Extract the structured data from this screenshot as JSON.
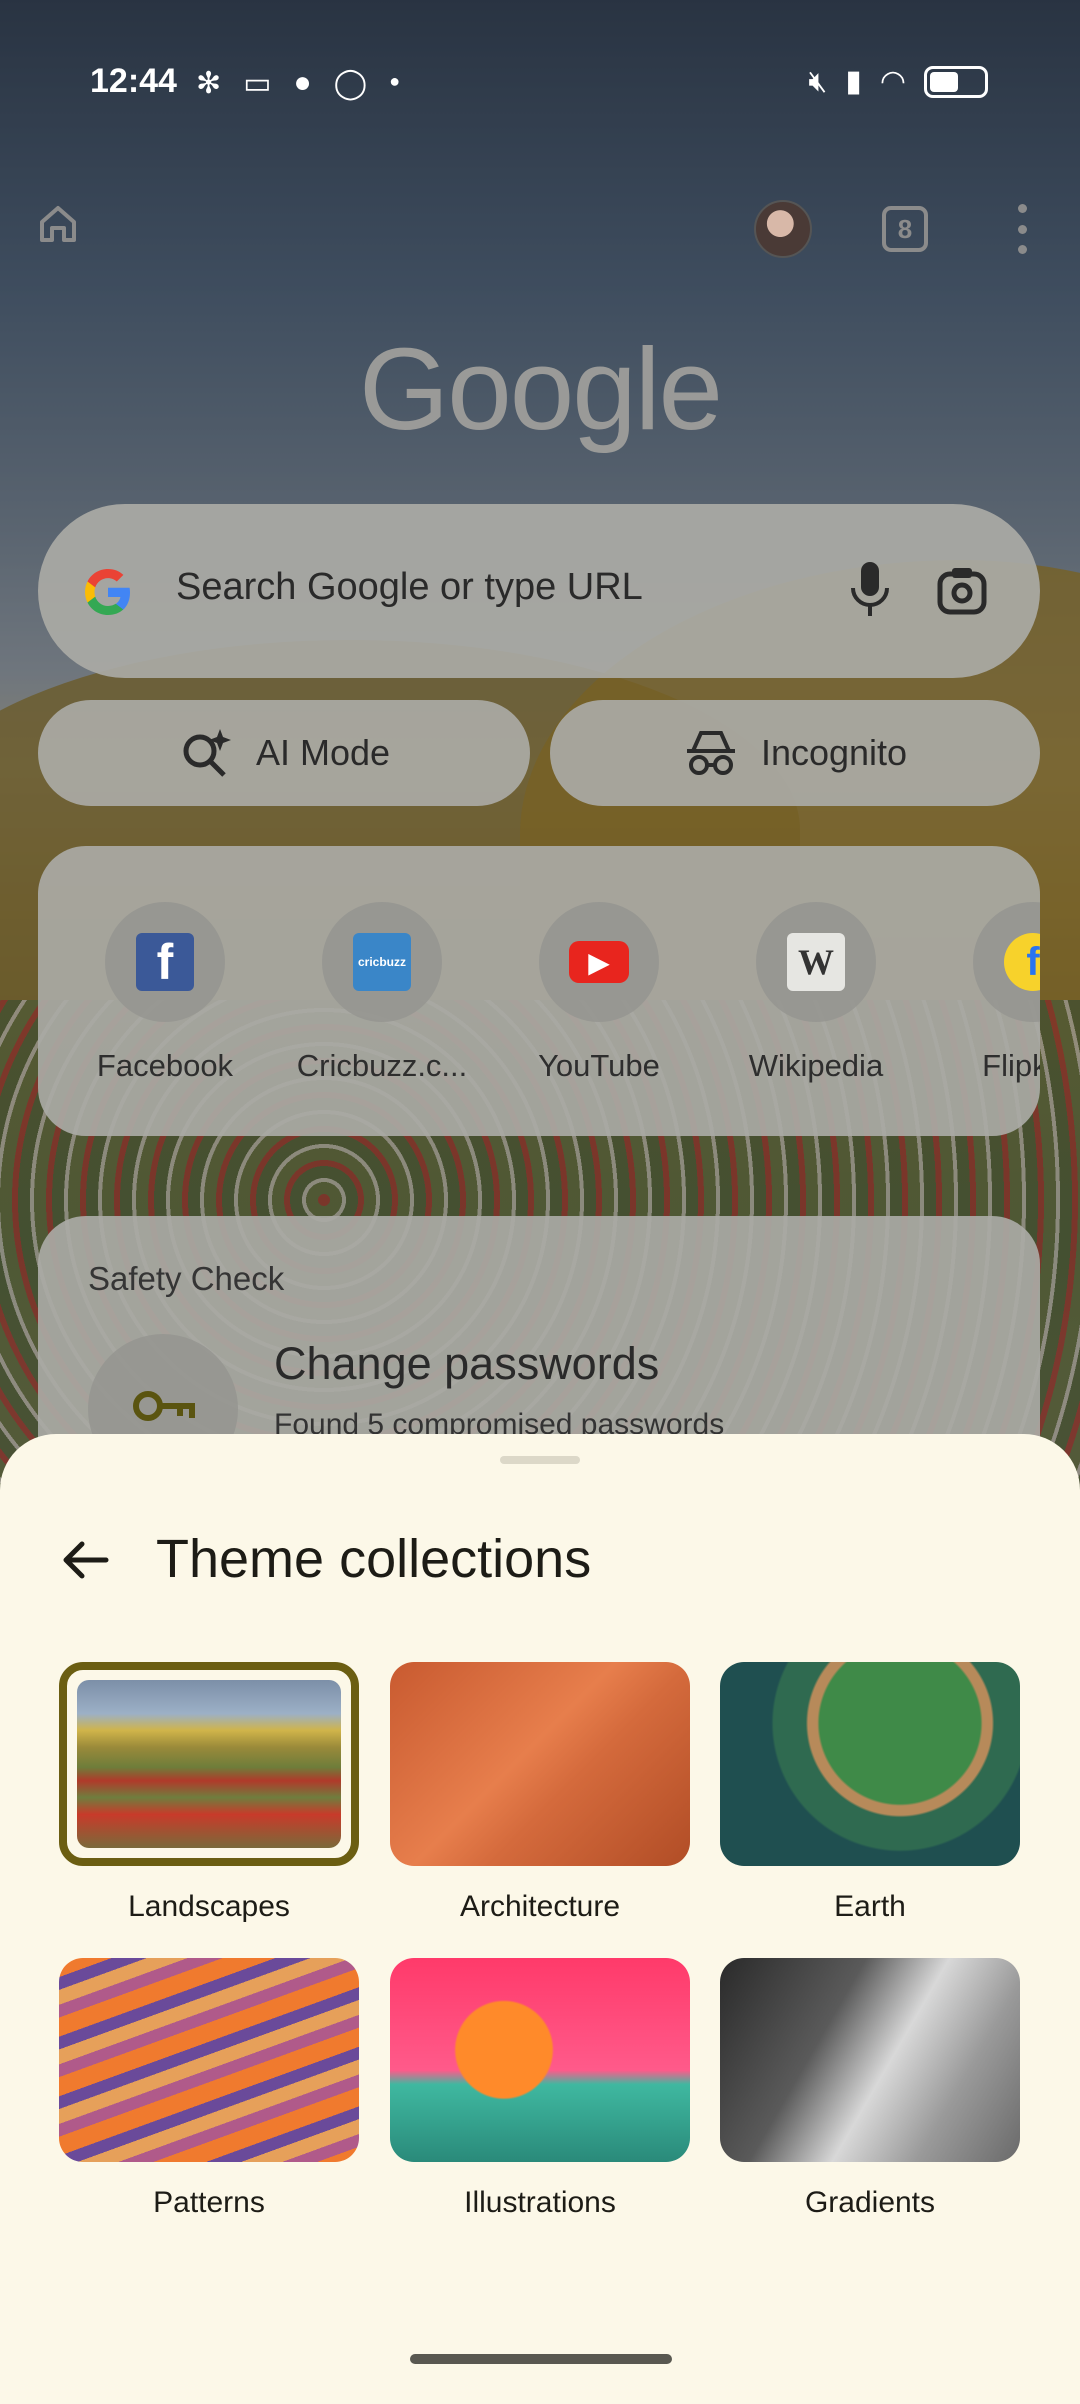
{
  "status_bar": {
    "time": "12:44",
    "notification_icons": [
      "slack-icon",
      "video-icon",
      "chat-icon",
      "whatsapp-icon",
      "dot-icon"
    ],
    "system_icons": [
      "mute-icon",
      "signal-icon",
      "wifi-icon",
      "battery-icon"
    ]
  },
  "toolbar": {
    "tab_count": "8"
  },
  "logo": "Google",
  "search": {
    "placeholder": "Search Google or type URL"
  },
  "chips": {
    "ai_mode": "AI Mode",
    "incognito": "Incognito"
  },
  "shortcuts": [
    {
      "label": "Facebook",
      "color": "#3b5998",
      "glyph": "f"
    },
    {
      "label": "Cricbuzz.c...",
      "color": "#3a86c8",
      "glyph": "cricbuzz"
    },
    {
      "label": "YouTube",
      "color": "#ff0000",
      "glyph": "▶"
    },
    {
      "label": "Wikipedia",
      "color": "#e8e8e8",
      "glyph": "W"
    },
    {
      "label": "Flipkart",
      "color": "#f7d22b",
      "glyph": "f"
    }
  ],
  "safety_check": {
    "title": "Safety Check",
    "heading": "Change passwords",
    "subtitle": "Found 5 compromised passwords"
  },
  "sheet": {
    "title": "Theme collections",
    "collections": [
      {
        "label": "Landscapes",
        "selected": true
      },
      {
        "label": "Architecture",
        "selected": false
      },
      {
        "label": "Earth",
        "selected": false
      },
      {
        "label": "Patterns",
        "selected": false
      },
      {
        "label": "Illustrations",
        "selected": false
      },
      {
        "label": "Gradients",
        "selected": false
      }
    ]
  },
  "colors": {
    "sheet_bg": "#fcf8e8",
    "selected_border": "#6b5e12"
  }
}
